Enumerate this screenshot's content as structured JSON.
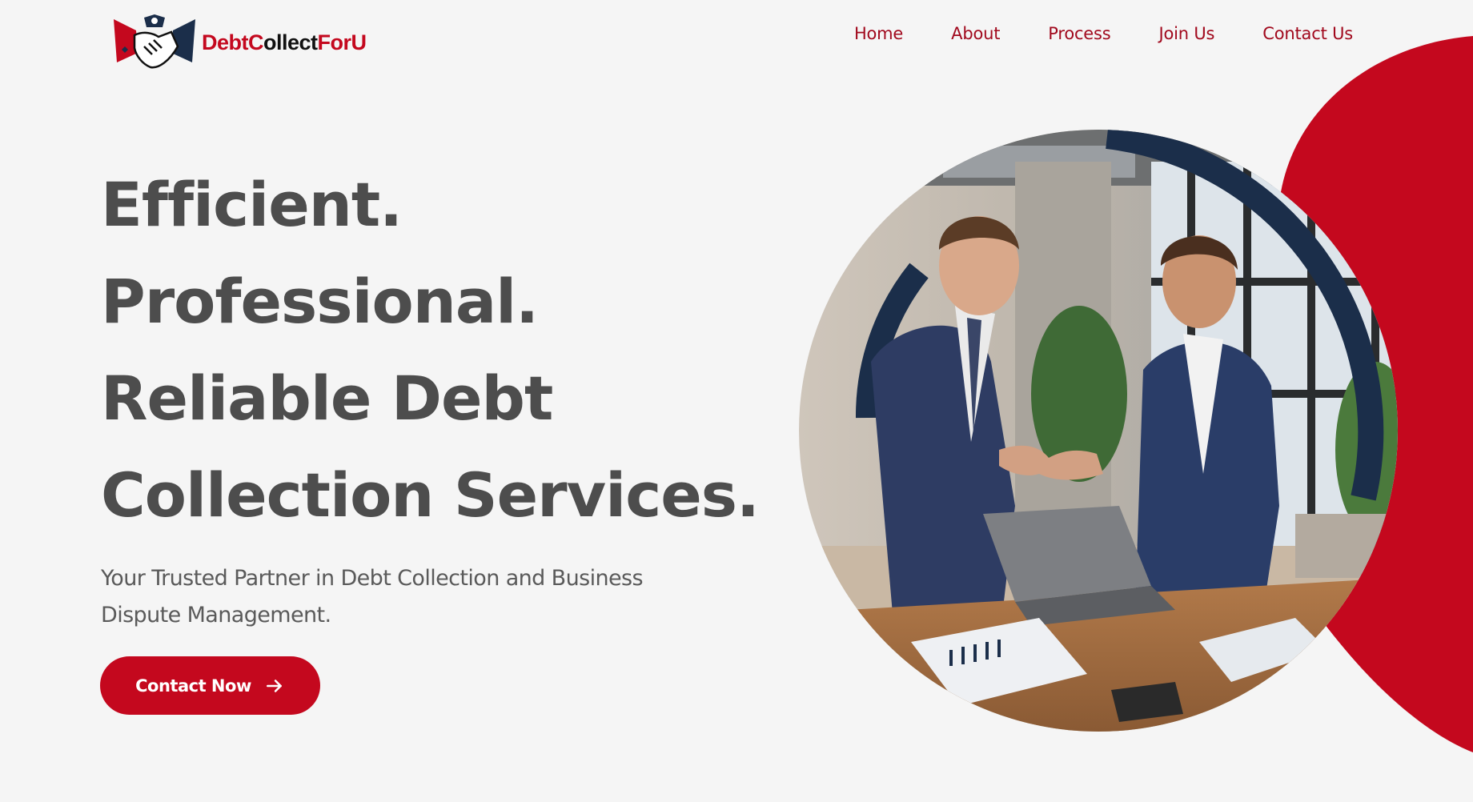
{
  "brand": {
    "name_parts": [
      "Debt",
      "C",
      "ollect",
      "For",
      "U"
    ],
    "colors": {
      "accent": "#c4081e",
      "accent_dark": "#a1091d",
      "navy": "#1b2e4a",
      "text": "#4d4d4d",
      "background": "#f5f5f5"
    },
    "logo_icon": "handshake-logo-icon"
  },
  "nav": {
    "items": [
      {
        "label": "Home"
      },
      {
        "label": "About"
      },
      {
        "label": "Process"
      },
      {
        "label": "Join Us"
      },
      {
        "label": "Contact Us"
      }
    ]
  },
  "hero": {
    "headline_lines": [
      "Efficient.",
      "Professional.",
      "Reliable Debt",
      "Collection Services."
    ],
    "subtext": "Your Trusted Partner in Debt Collection and Business Dispute Management.",
    "cta_label": "Contact Now",
    "cta_icon": "arrow-right-icon",
    "image_icon": "business-handshake-photo"
  }
}
